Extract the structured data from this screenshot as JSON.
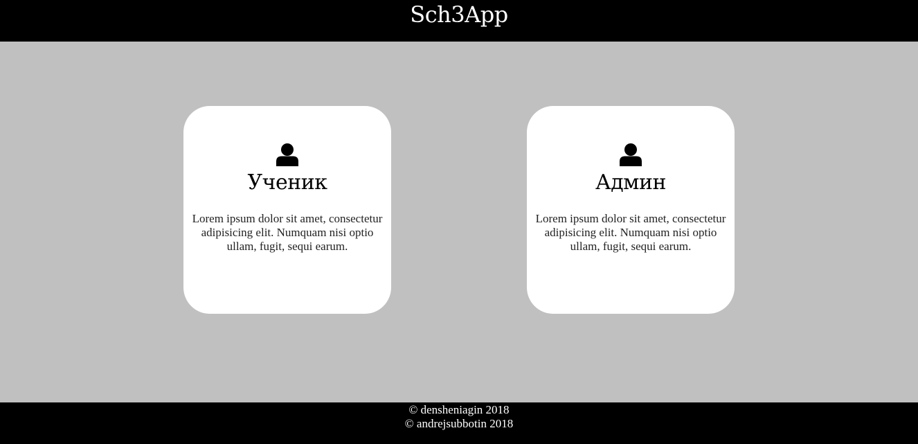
{
  "header": {
    "title": "Sch3App"
  },
  "cards": [
    {
      "icon": "user-icon",
      "title": "Ученик",
      "description": "Lorem ipsum dolor sit amet, consectetur adipisicing elit. Numquam nisi optio ullam, fugit, sequi earum."
    },
    {
      "icon": "user-icon",
      "title": "Админ",
      "description": "Lorem ipsum dolor sit amet, consectetur adipisicing elit. Numquam nisi optio ullam, fugit, sequi earum."
    }
  ],
  "footer": {
    "lines": [
      "© densheniagin 2018",
      "© andrejsubbotin 2018"
    ]
  },
  "colors": {
    "header_bg": "#000000",
    "page_bg": "#c0c0c0",
    "card_bg": "#ffffff",
    "footer_bg": "#000000"
  }
}
